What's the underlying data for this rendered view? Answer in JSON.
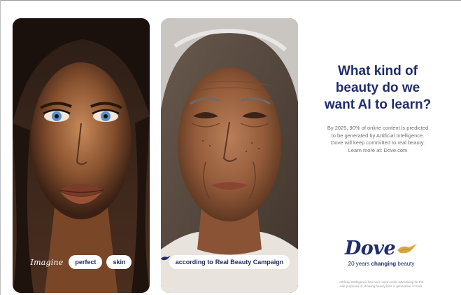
{
  "left_card": {
    "imagine_text": "Imagine",
    "pills": [
      "perfect",
      "skin"
    ]
  },
  "right_card": {
    "pill_prefix": "according to",
    "pill_suffix": "Real Beauty Campaign"
  },
  "copy": {
    "headline_lines": [
      "What kind of",
      "beauty do we",
      "want AI to learn?"
    ],
    "body_lines": [
      "By 2025, 90% of online content is predicted",
      "to be generated by Artificial Intelligence.",
      "Dove will keep committed to real beauty.",
      "Learn more at: Dove.com"
    ]
  },
  "brand": {
    "name": "Dove",
    "tagline_prefix": "20 years",
    "tagline_bold": "changing",
    "tagline_suffix": "beauty"
  },
  "disclaimer_lines": [
    "Artificial Intelligence has been used in this advertising for the",
    "sole purposes of showing beauty bias in generative AI tools."
  ],
  "colors": {
    "navy": "#1f2d6b",
    "gold": "#d8a645",
    "gray_text": "#6f6f6f"
  }
}
